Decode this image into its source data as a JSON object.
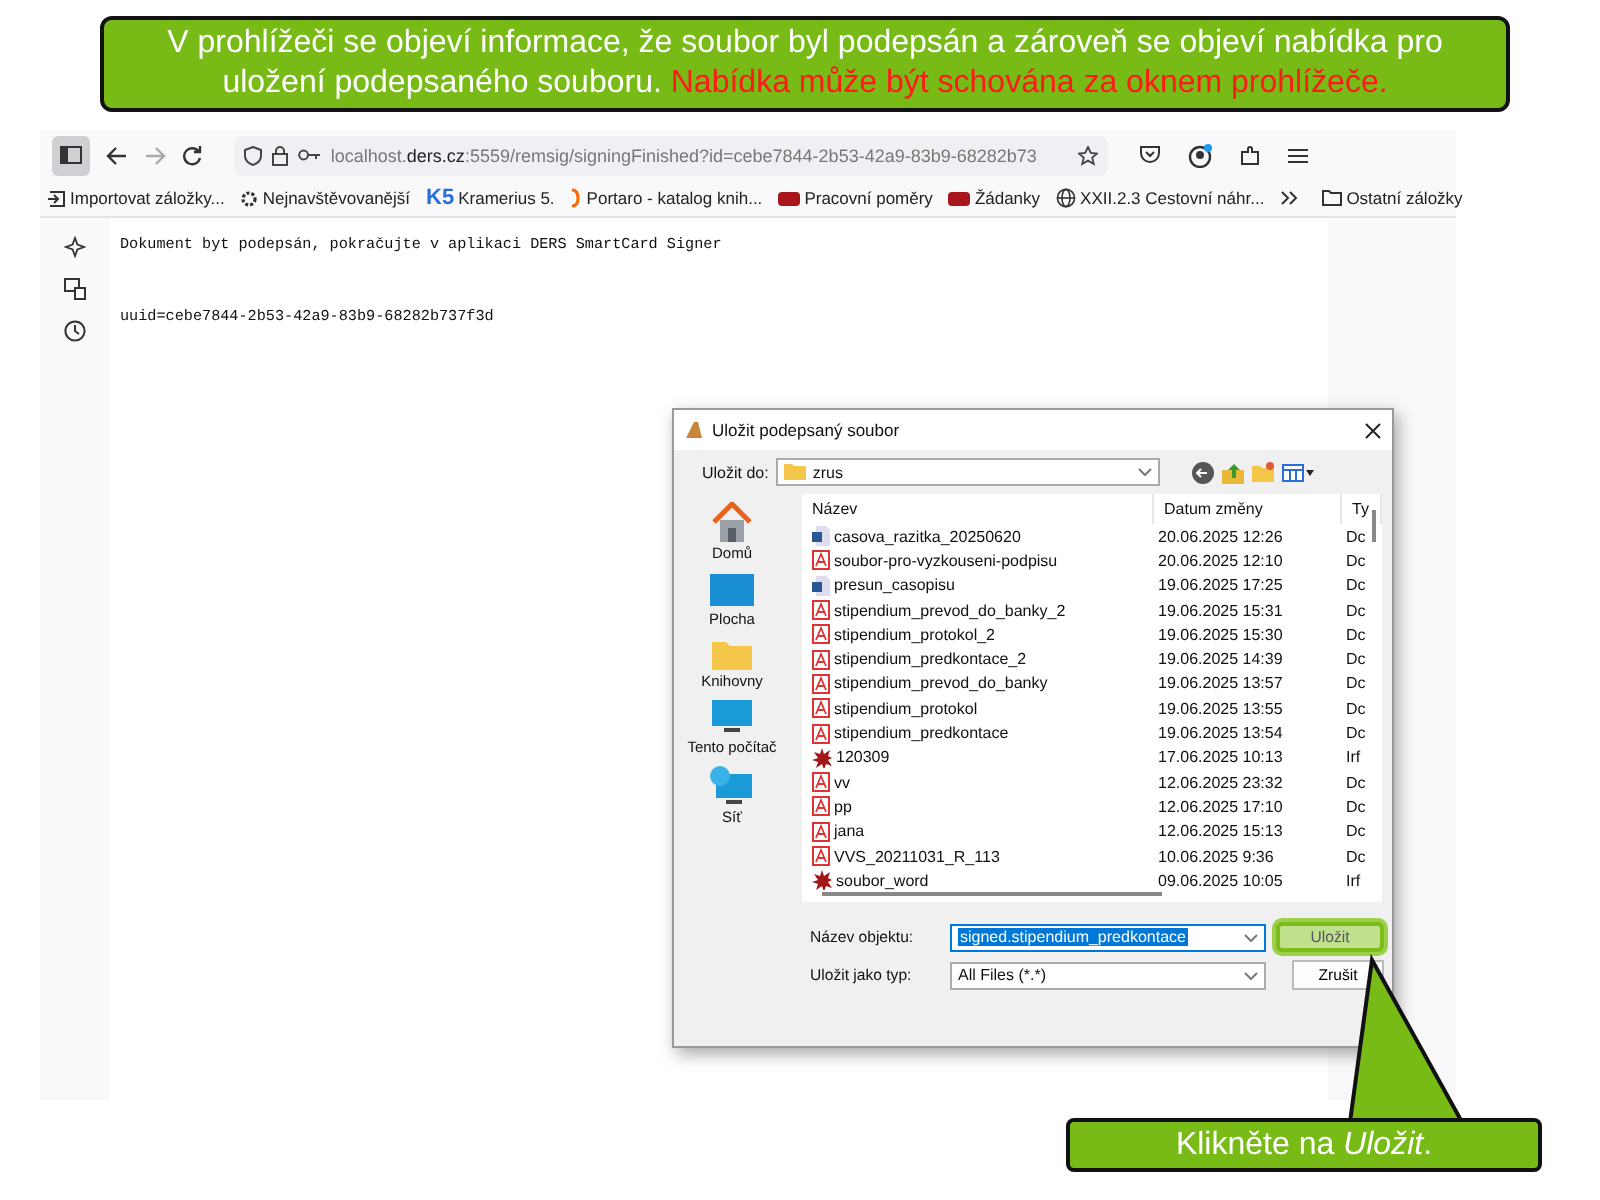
{
  "callout_top": {
    "segments": [
      {
        "kind": "normal",
        "text": "V prohlížeči se objeví informace, že soubor byl podepsán a zároveň se objeví nabídka pro uložení podepsaného souboru."
      },
      {
        "kind": "warning",
        "text": "Nabídka může být schována za oknem prohlížeče."
      }
    ]
  },
  "browser": {
    "url": "localhost.**ders.cz**:5559/remsig/signingFinished?id=cebe7844-2b53-42a9-83b9-68282b73",
    "bookmarks": [
      {
        "kind": "import",
        "label": "Importovat záložky..."
      },
      {
        "kind": "gear",
        "label": "Nejnavštěvovanější"
      },
      {
        "kind": "badge",
        "badge": "K5",
        "label": "Kramerius 5."
      },
      {
        "kind": "bracket",
        "label": "Portaro - katalog knih..."
      },
      {
        "kind": "red",
        "label": "Pracovní poměry"
      },
      {
        "kind": "red",
        "label": "Žádanky"
      },
      {
        "kind": "globe",
        "label": "XXII.2.3 Cestovní náhr..."
      }
    ],
    "other_bookmarks": "Ostatní záložky",
    "content_lines": [
      "Dokument byt podepsán, pokračujte v aplikaci DERS SmartCard Signer",
      "uuid=cebe7844-2b53-42a9-83b9-68282b737f3d"
    ]
  },
  "dialog": {
    "title": "Uložit podepsaný soubor",
    "save_in_label": "Uložit do:",
    "save_in_value": "zrus",
    "places": [
      {
        "kind": "home",
        "label": "Domů"
      },
      {
        "kind": "desktop",
        "label": "Plocha"
      },
      {
        "kind": "folder",
        "label": "Knihovny"
      },
      {
        "kind": "computer",
        "label": "Tento počítač"
      },
      {
        "kind": "network",
        "label": "Síť"
      }
    ],
    "columns": [
      "Název",
      "Datum změny",
      "Ty"
    ],
    "files": [
      {
        "kind": "word",
        "name": "casova_razitka_20250620",
        "date": "20.06.2025 12:26",
        "type": "Dc"
      },
      {
        "kind": "pdf",
        "name": "soubor-pro-vyzkouseni-podpisu",
        "date": "20.06.2025 12:10",
        "type": "Dc"
      },
      {
        "kind": "word",
        "name": "presun_casopisu",
        "date": "19.06.2025 17:25",
        "type": "Dc"
      },
      {
        "kind": "pdf",
        "name": "stipendium_prevod_do_banky_2",
        "date": "19.06.2025 15:31",
        "type": "Dc"
      },
      {
        "kind": "pdf",
        "name": "stipendium_protokol_2",
        "date": "19.06.2025 15:30",
        "type": "Dc"
      },
      {
        "kind": "pdf",
        "name": "stipendium_predkontace_2",
        "date": "19.06.2025 14:39",
        "type": "Dc"
      },
      {
        "kind": "pdf",
        "name": "stipendium_prevod_do_banky",
        "date": "19.06.2025 13:57",
        "type": "Dc"
      },
      {
        "kind": "pdf",
        "name": "stipendium_protokol",
        "date": "19.06.2025 13:55",
        "type": "Dc"
      },
      {
        "kind": "pdf",
        "name": "stipendium_predkontace",
        "date": "19.06.2025 13:54",
        "type": "Dc"
      },
      {
        "kind": "other",
        "name": "120309",
        "date": "17.06.2025 10:13",
        "type": "Irf"
      },
      {
        "kind": "pdf",
        "name": "vv",
        "date": "12.06.2025 23:32",
        "type": "Dc"
      },
      {
        "kind": "pdf",
        "name": "pp",
        "date": "12.06.2025 17:10",
        "type": "Dc"
      },
      {
        "kind": "pdf",
        "name": "jana",
        "date": "12.06.2025 15:13",
        "type": "Dc"
      },
      {
        "kind": "pdf",
        "name": "VVS_20211031_R_113",
        "date": "10.06.2025 9:36",
        "type": "Dc"
      },
      {
        "kind": "other",
        "name": "soubor_word",
        "date": "09.06.2025 10:05",
        "type": "Irf"
      }
    ],
    "filename_label": "Název objektu:",
    "filename_value": "signed.stipendium_predkontace",
    "filename_selected": true,
    "filetype_label": "Uložit jako typ:",
    "filetype_value": "All Files (*.*)",
    "buttons": [
      {
        "label": "Uložit",
        "highlighted": true
      },
      {
        "label": "Zrušit",
        "highlighted": false
      }
    ]
  },
  "callout_bottom": {
    "text": "Klikněte na *Uložit*."
  }
}
